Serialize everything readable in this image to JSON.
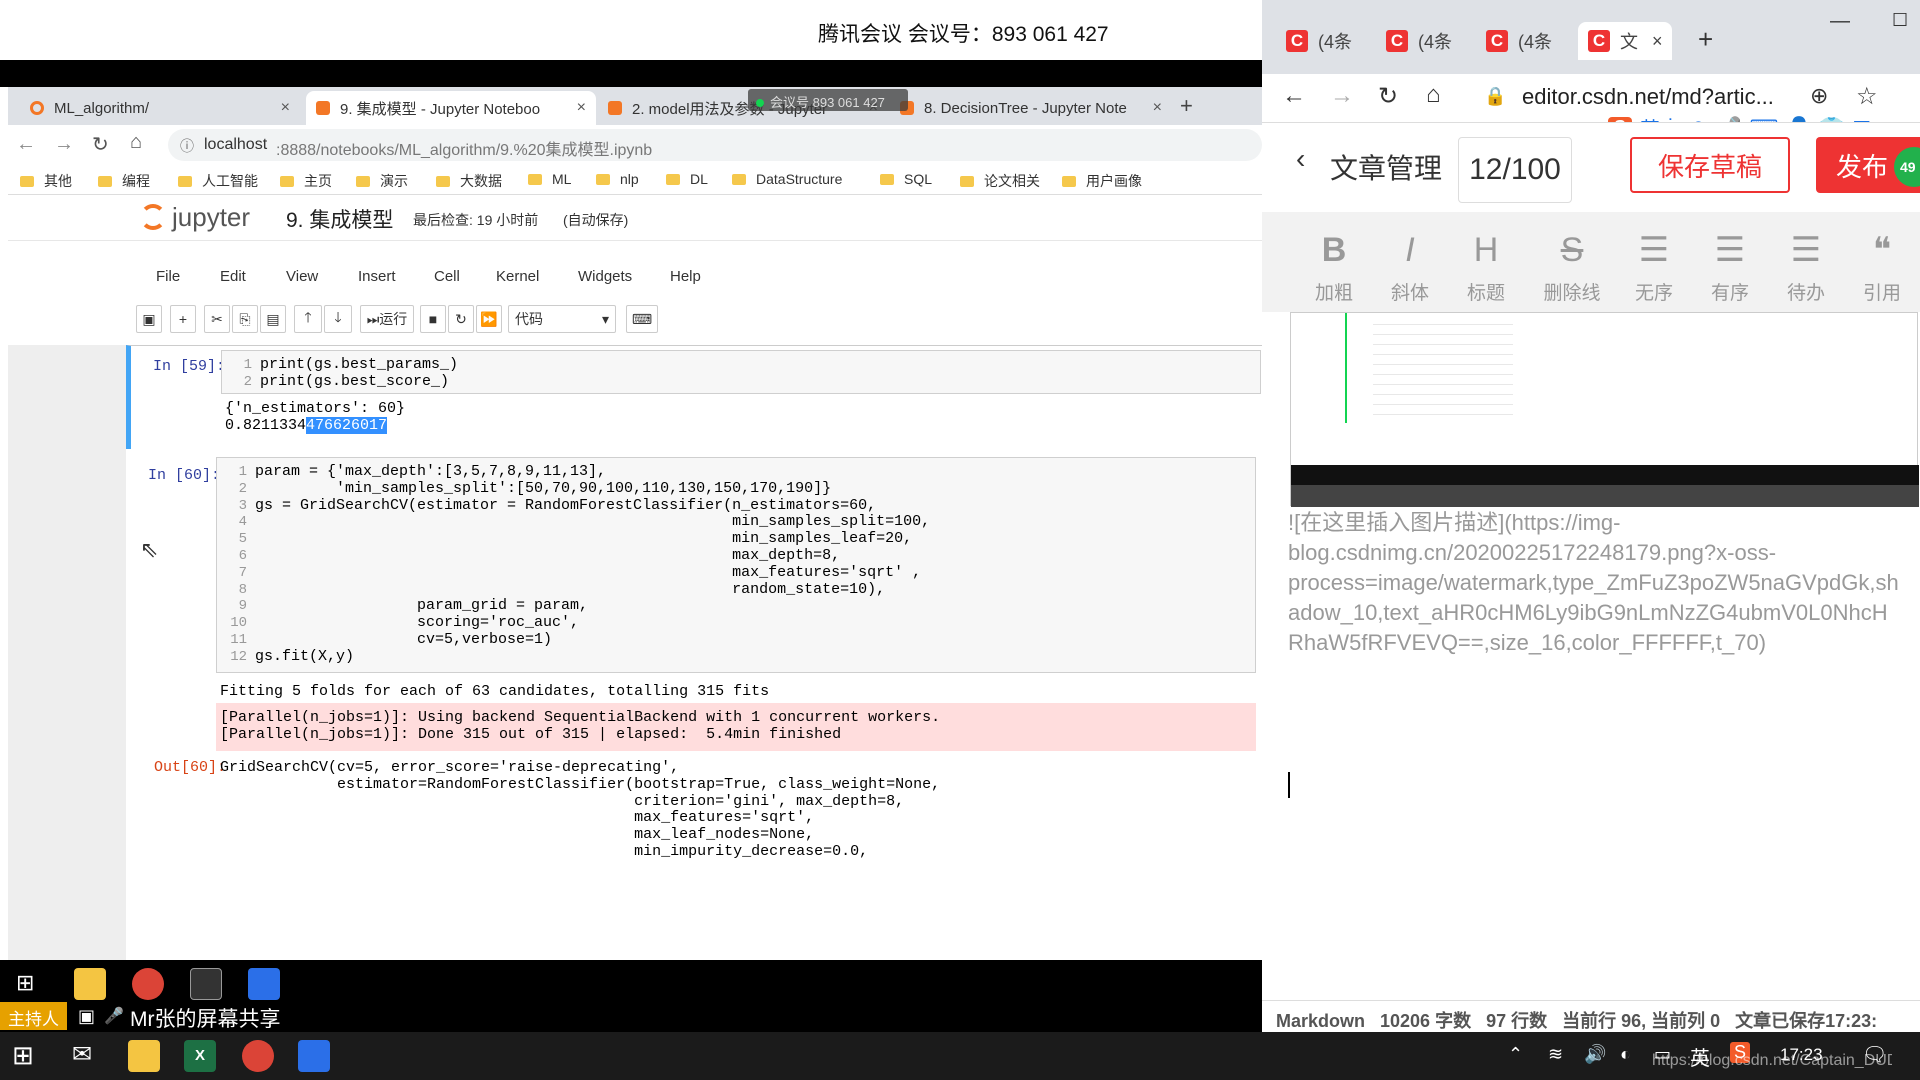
{
  "meeting": {
    "banner": "腾讯会议 会议号：893 061 427",
    "overlay_label": "会议号 893 061 427"
  },
  "browser": {
    "tabs": [
      {
        "label": "ML_algorithm/",
        "close": "×"
      },
      {
        "label": "9. 集成模型 - Jupyter Noteboo",
        "close": "×"
      },
      {
        "label": "2. model用法及参数 - Jupyter",
        "close": "×"
      },
      {
        "label": "8. DecisionTree - Jupyter Note",
        "close": "×"
      }
    ],
    "new_tab": "+",
    "url_host": "localhost",
    "url_rest": ":8888/notebooks/ML_algorithm/9.%20集成模型.ipynb",
    "bookmarks": [
      "其他",
      "编程",
      "人工智能",
      "主页",
      "演示",
      "大数据",
      "ML",
      "nlp",
      "DL",
      "DataStructure",
      "SQL",
      "论文相关",
      "用户画像"
    ]
  },
  "jupyter": {
    "logo_text": "jupyter",
    "notebook_title": "9. 集成模型",
    "checkpoint": "最后检查: 19 小时前",
    "autosave": "(自动保存)",
    "menus": [
      "File",
      "Edit",
      "View",
      "Insert",
      "Cell",
      "Kernel",
      "Widgets",
      "Help"
    ],
    "toolbar": {
      "run_label": "运行",
      "cell_type": "代码"
    },
    "cells": [
      {
        "prompt": "In  [59]:",
        "line_numbers": [
          "1",
          "2"
        ],
        "code": [
          "print(gs.best_params_)",
          "print(gs.best_score_)"
        ],
        "output": [
          "{'n_estimators': 60}"
        ],
        "output_score_plain": "0.8211334",
        "output_score_selected": "476626017"
      },
      {
        "prompt": "In  [60]:",
        "line_numbers": [
          "1",
          "2",
          "3",
          "4",
          "5",
          "6",
          "7",
          "8",
          "9",
          "10",
          "11",
          "12"
        ],
        "code": [
          "param = {'max_depth':[3,5,7,8,9,11,13],",
          "         'min_samples_split':[50,70,90,100,110,130,150,170,190]}",
          "gs = GridSearchCV(estimator = RandomForestClassifier(n_estimators=60,",
          "                                                     min_samples_split=100,",
          "                                                     min_samples_leaf=20,",
          "                                                     max_depth=8,",
          "                                                     max_features='sqrt' ,",
          "                                                     random_state=10),",
          "                  param_grid = param,",
          "                  scoring='roc_auc',",
          "                  cv=5,verbose=1)",
          "gs.fit(X,y)"
        ],
        "stdout": "Fitting 5 folds for each of 63 candidates, totalling 315 fits",
        "stderr": [
          "[Parallel(n_jobs=1)]: Using backend SequentialBackend with 1 concurrent workers.",
          "[Parallel(n_jobs=1)]: Done 315 out of 315 | elapsed:  5.4min finished"
        ],
        "out_prompt": "Out[60]:",
        "out_lines": [
          "GridSearchCV(cv=5, error_score='raise-deprecating',",
          "             estimator=RandomForestClassifier(bootstrap=True, class_weight=None,",
          "                                              criterion='gini', max_depth=8,",
          "                                              max_features='sqrt',",
          "                                              max_leaf_nodes=None,",
          "                                              min_impurity_decrease=0.0,"
        ]
      }
    ]
  },
  "editor": {
    "tabs": [
      "(4条",
      "(4条",
      "(4条",
      "文"
    ],
    "tab_close": "×",
    "new_tab": "+",
    "url": "editor.csdn.net/md?artic...",
    "back_label": "文章管理",
    "title_count": "12/100",
    "save_draft": "保存草稿",
    "publish": "发布",
    "badge": "49",
    "ime_label": "英",
    "format_buttons": [
      {
        "glyph": "B",
        "label": "加粗"
      },
      {
        "glyph": "I",
        "label": "斜体"
      },
      {
        "glyph": "H",
        "label": "标题"
      },
      {
        "glyph": "S",
        "label": "删除线"
      },
      {
        "glyph": "☰",
        "label": "无序"
      },
      {
        "glyph": "☰",
        "label": "有序"
      },
      {
        "glyph": "☰",
        "label": "待办"
      },
      {
        "glyph": "❝",
        "label": "引用"
      }
    ],
    "markdown_lines": [
      "![在这里插入图片描述](https://img-",
      "blog.csdnimg.cn/20200225172248179.png?x-oss-",
      "process=image/watermark,type_ZmFuZ3poZW5naGVpdGk,sh",
      "adow_10,text_aHR0cHM6Ly9ibG9nLmNzZG4ubmV0L0NhcH",
      "RhaW5fRFVEVQ==,size_16,color_FFFFFF,t_70)"
    ],
    "status": "Markdown   10206 字数   97 行数   当前行 96, 当前列 0   文章已保存17:23:"
  },
  "meeting_share": {
    "host_label": "主持人",
    "sharer": "Mr张的屏幕共享"
  },
  "taskbar": {
    "ime": "英",
    "time": "17:23",
    "watermark_url": "https://blog.csdn.net/Captain_DUDU"
  },
  "colors": {
    "jupyter_orange": "#f37726",
    "cell_active_blue": "#42a5f5",
    "stderr_bg": "#fdd",
    "csdn_red": "#e33",
    "meeting_green": "#13d451"
  }
}
